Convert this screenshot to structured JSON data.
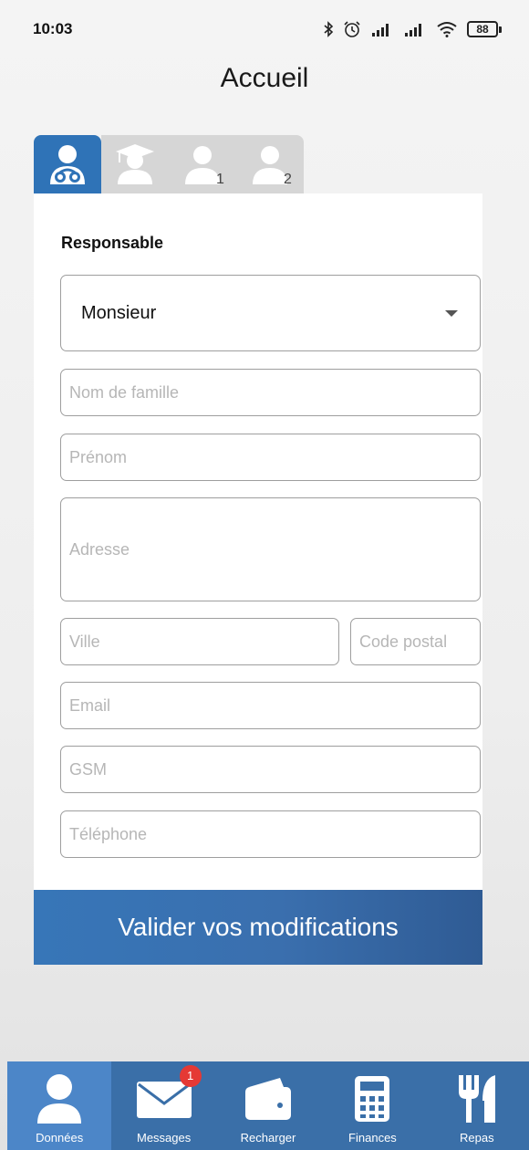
{
  "status_bar": {
    "time": "10:03",
    "battery": "88"
  },
  "header": {
    "title": "Accueil"
  },
  "tabs": [
    {
      "icon": "doctor-icon",
      "number": "",
      "active": true
    },
    {
      "icon": "graduate-icon",
      "number": "",
      "active": false
    },
    {
      "icon": "person-icon",
      "number": "1",
      "active": false
    },
    {
      "icon": "person-icon",
      "number": "2",
      "active": false
    }
  ],
  "form": {
    "section_title": "Responsable",
    "civility": {
      "value": "Monsieur"
    },
    "last_name": {
      "placeholder": "Nom de famille",
      "value": ""
    },
    "first_name": {
      "placeholder": "Prénom",
      "value": ""
    },
    "address": {
      "placeholder": "Adresse",
      "value": ""
    },
    "city": {
      "placeholder": "Ville",
      "value": ""
    },
    "postal_code": {
      "placeholder": "Code postal",
      "value": ""
    },
    "email": {
      "placeholder": "Email",
      "value": ""
    },
    "mobile": {
      "placeholder": "GSM",
      "value": ""
    },
    "phone": {
      "placeholder": "Téléphone",
      "value": ""
    },
    "submit_label": "Valider vos modifications"
  },
  "bottom_nav": {
    "items": [
      {
        "label": "Données",
        "icon": "user-icon",
        "active": true
      },
      {
        "label": "Messages",
        "icon": "envelope-icon",
        "badge": "1"
      },
      {
        "label": "Recharger",
        "icon": "wallet-icon"
      },
      {
        "label": "Finances",
        "icon": "calculator-icon"
      },
      {
        "label": "Repas",
        "icon": "fork-knife-icon"
      }
    ]
  },
  "colors": {
    "accent": "#2f73b7",
    "nav_background": "#3a6fa8",
    "nav_active": "#4c86c8",
    "badge": "#e53935",
    "tab_inactive": "#d6d6d6"
  }
}
